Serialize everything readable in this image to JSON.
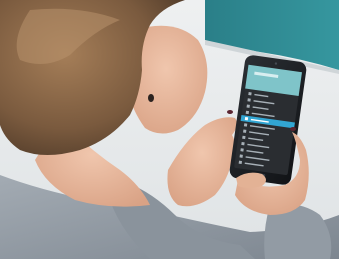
{
  "photo": {
    "subject": "person",
    "held_object": "smartphone",
    "colors": {
      "wall": "#2f8e96",
      "floor": "#e6e9ea",
      "hair": "#7a5a3e",
      "skin": "#e7b79b",
      "sweater": "#8f98a1",
      "phone_body": "#1b1e22",
      "menu_header": "#7fc4c9",
      "menu_background": "#2a2d31",
      "menu_highlight": "#32a6d3",
      "menu_text": "#a7b0b7",
      "nail_polish": "#5a2430"
    }
  },
  "phone_screen": {
    "header_title": "",
    "menu_items": [
      {
        "label": "",
        "highlighted": false
      },
      {
        "label": "",
        "highlighted": false
      },
      {
        "label": "",
        "highlighted": false
      },
      {
        "label": "",
        "highlighted": false
      },
      {
        "label": "",
        "highlighted": true
      },
      {
        "label": "",
        "highlighted": false
      },
      {
        "label": "",
        "highlighted": false
      },
      {
        "label": "",
        "highlighted": false
      },
      {
        "label": "",
        "highlighted": false
      },
      {
        "label": "",
        "highlighted": false
      },
      {
        "label": "",
        "highlighted": false
      },
      {
        "label": "",
        "highlighted": false
      }
    ]
  }
}
